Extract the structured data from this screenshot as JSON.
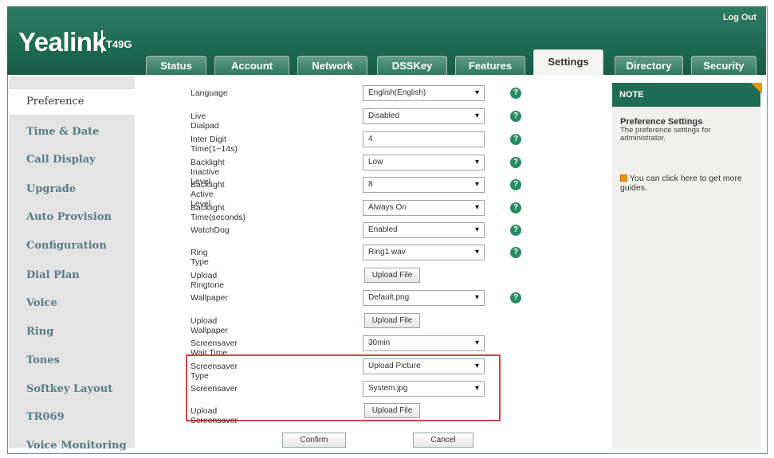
{
  "header": {
    "brand": "Yealink",
    "model": "T49G",
    "logout": "Log Out"
  },
  "tabs": [
    "Status",
    "Account",
    "Network",
    "DSSKey",
    "Features",
    "Settings",
    "Directory",
    "Security"
  ],
  "active_tab": "Settings",
  "sidebar": {
    "items": [
      "Preference",
      "Time & Date",
      "Call Display",
      "Upgrade",
      "Auto Provision",
      "Configuration",
      "Dial Plan",
      "Voice",
      "Ring",
      "Tones",
      "Softkey Layout",
      "TR069",
      "Voice Monitoring"
    ]
  },
  "form": {
    "rows": [
      {
        "label": "Language",
        "value": "English(English)",
        "type": "select",
        "help": true
      },
      {
        "label": "Live Dialpad",
        "value": "Disabled",
        "type": "select",
        "help": true
      },
      {
        "label": "Inter Digit Time(1~14s)",
        "value": "4",
        "type": "text",
        "help": true
      },
      {
        "label": "Backlight Inactive Level",
        "value": "Low",
        "type": "select",
        "help": true
      },
      {
        "label": "Backlight Active Level",
        "value": "8",
        "type": "select",
        "help": true
      },
      {
        "label": "Backlight Time(seconds)",
        "value": "Always On",
        "type": "select",
        "help": true
      },
      {
        "label": "WatchDog",
        "value": "Enabled",
        "type": "select",
        "help": true
      },
      {
        "label": "Ring Type",
        "value": "Ring1.wav",
        "type": "select",
        "help": true
      },
      {
        "label": "Upload Ringtone",
        "value": "Upload File",
        "type": "button",
        "help": false
      },
      {
        "label": "Wallpaper",
        "value": "Default.png",
        "type": "select",
        "help": true
      },
      {
        "label": "Upload Wallpaper",
        "value": "Upload File",
        "type": "button",
        "help": false
      },
      {
        "label": "Screensaver Wait Time",
        "value": "30min",
        "type": "select",
        "help": false
      },
      {
        "label": "Screensaver Type",
        "value": "Upload Picture",
        "type": "select",
        "help": false
      },
      {
        "label": "Screensaver",
        "value": "System.jpg",
        "type": "select",
        "help": false
      },
      {
        "label": "Upload Screensaver",
        "value": "Upload File",
        "type": "button",
        "help": false
      }
    ],
    "confirm": "Confirm",
    "cancel": "Cancel"
  },
  "note": {
    "title": "NOTE",
    "heading": "Preference Settings",
    "description": "The preference settings for administrator.",
    "guide": "You can click here to get more guides."
  },
  "colors": {
    "header_green": "#1f6b53",
    "accent_orange": "#f29400",
    "highlight_red": "#d24545"
  }
}
